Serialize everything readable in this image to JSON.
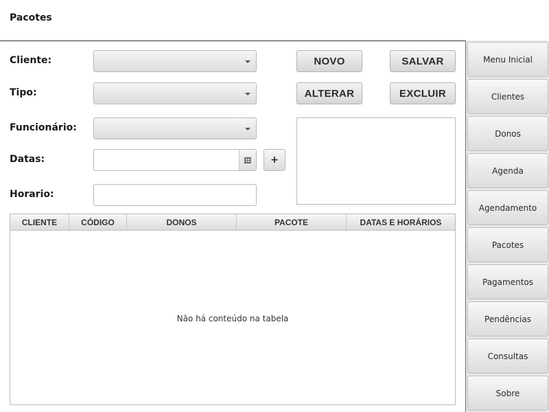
{
  "header": {
    "title": "Pacotes"
  },
  "form": {
    "cliente_label": "Cliente:",
    "tipo_label": "Tipo:",
    "funcionario_label": "Funcionário:",
    "datas_label": "Datas:",
    "horario_label": "Horario:",
    "cliente_value": "",
    "tipo_value": "",
    "funcionario_value": "",
    "datas_value": "",
    "horario_value": "",
    "add_date_label": "+"
  },
  "actions": {
    "novo": "NOVO",
    "salvar": "SALVAR",
    "alterar": "ALTERAR",
    "excluir": "EXCLUIR"
  },
  "table": {
    "columns": [
      "CLIENTE",
      "CÓDIGO",
      "DONOS",
      "PACOTE",
      "DATAS E HORÁRIOS"
    ],
    "empty_message": "Não há conteúdo na tabela",
    "rows": []
  },
  "sidebar": {
    "items": [
      {
        "label": "Menu Inicial"
      },
      {
        "label": "Clientes"
      },
      {
        "label": "Donos"
      },
      {
        "label": "Agenda"
      },
      {
        "label": "Agendamento"
      },
      {
        "label": "Pacotes"
      },
      {
        "label": "Pagamentos"
      },
      {
        "label": "Pendências"
      },
      {
        "label": "Consultas"
      },
      {
        "label": "Sobre"
      }
    ]
  },
  "icons": {
    "calendar": "calendar-icon",
    "dropdown": "chevron-down-icon"
  }
}
